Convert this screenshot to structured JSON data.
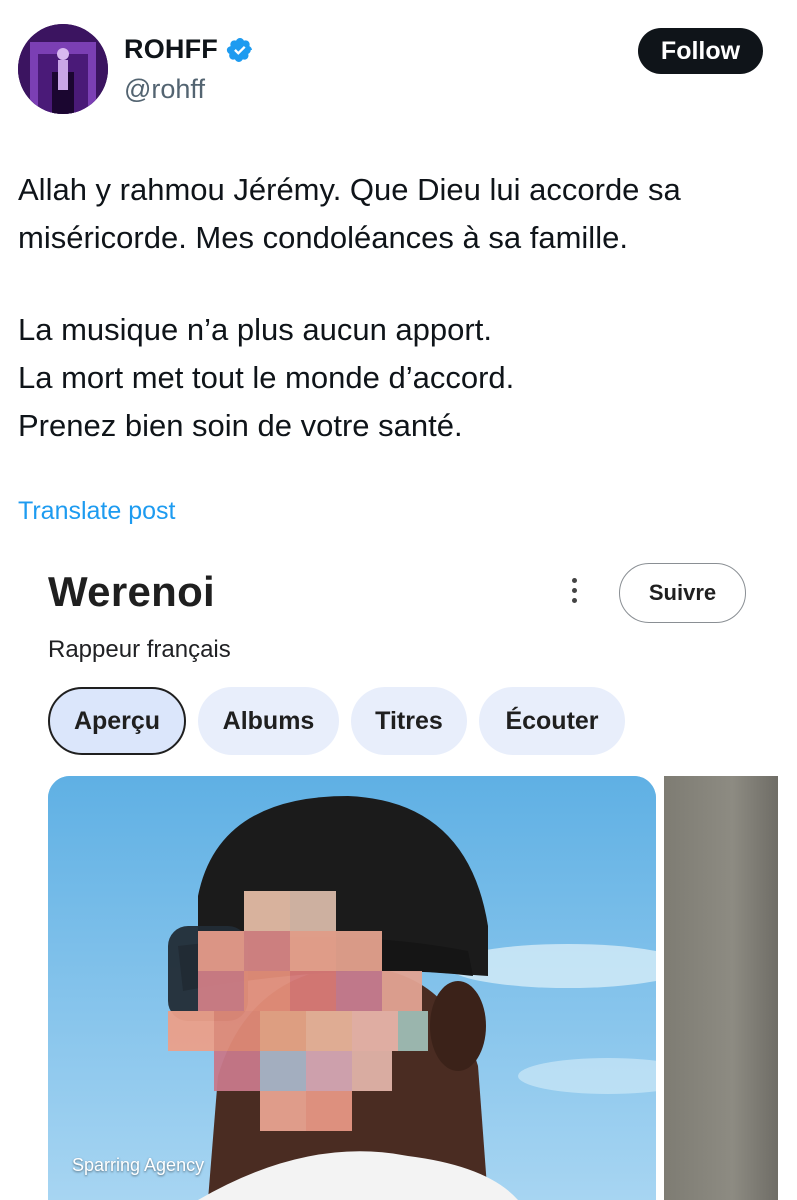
{
  "post": {
    "author_name": "ROHFF",
    "author_handle": "@rohff",
    "follow_label": "Follow",
    "text_lines_1": [
      "Allah y rahmou Jérémy. Que Dieu lui accorde sa",
      "miséricorde. Mes condoléances à sa famille."
    ],
    "text_lines_2": [
      "La musique n’a plus aucun apport.",
      "La mort met tout le monde d’accord.",
      "Prenez bien soin de votre santé."
    ],
    "translate_label": "Translate post",
    "accent_color": "#1d9bf0"
  },
  "knowledge_panel": {
    "title": "Werenoi",
    "subtitle": "Rappeur français",
    "follow_label": "Suivre",
    "tabs": [
      {
        "label": "Aperçu",
        "active": true
      },
      {
        "label": "Albums",
        "active": false
      },
      {
        "label": "Titres",
        "active": false
      },
      {
        "label": "Écouter",
        "active": false
      }
    ],
    "photo_credit": "Sparring Agency"
  }
}
